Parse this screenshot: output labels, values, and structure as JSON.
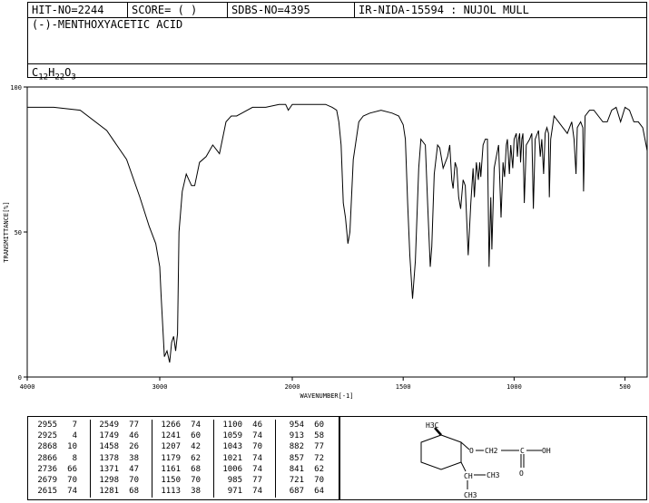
{
  "header": {
    "hit_no": "HIT-NO=2244",
    "score": "SCORE=  (   )",
    "sdbs_no": "SDBS-NO=4395",
    "ir_no": "IR-NIDA-15594 : NUJOL MULL",
    "compound": "(-)-MENTHOXYACETIC ACID",
    "formula": {
      "c": "C",
      "n1": "12",
      "h": "H",
      "n2": "22",
      "o": "O",
      "n3": "3"
    }
  },
  "chart_data": {
    "type": "line",
    "xlabel": "WAVENUMBER[-1]",
    "ylabel": "TRANSMITTANCE[%]",
    "xlim": [
      4000,
      400
    ],
    "ylim": [
      0,
      100
    ],
    "x_ticks": [
      4000,
      3000,
      2000,
      1500,
      1000,
      500
    ],
    "y_ticks": [
      0,
      50,
      100
    ],
    "x": [
      4000,
      3800,
      3600,
      3400,
      3250,
      3150,
      3080,
      3030,
      3000,
      2990,
      2965,
      2945,
      2925,
      2910,
      2895,
      2880,
      2866,
      2855,
      2830,
      2800,
      2760,
      2736,
      2700,
      2650,
      2600,
      2549,
      2500,
      2460,
      2420,
      2380,
      2300,
      2200,
      2100,
      2050,
      2030,
      2000,
      1950,
      1900,
      1850,
      1820,
      1800,
      1790,
      1780,
      1770,
      1760,
      1749,
      1740,
      1725,
      1700,
      1680,
      1650,
      1600,
      1550,
      1520,
      1500,
      1490,
      1480,
      1470,
      1458,
      1445,
      1430,
      1420,
      1400,
      1390,
      1378,
      1371,
      1360,
      1345,
      1335,
      1320,
      1300,
      1290,
      1281,
      1275,
      1266,
      1258,
      1250,
      1241,
      1230,
      1220,
      1207,
      1195,
      1185,
      1179,
      1170,
      1161,
      1155,
      1150,
      1140,
      1130,
      1120,
      1113,
      1105,
      1100,
      1090,
      1080,
      1070,
      1059,
      1050,
      1043,
      1035,
      1030,
      1021,
      1015,
      1006,
      1000,
      990,
      985,
      980,
      975,
      971,
      965,
      960,
      954,
      945,
      930,
      920,
      913,
      905,
      890,
      882,
      875,
      867,
      860,
      852,
      845,
      841,
      835,
      820,
      800,
      780,
      760,
      740,
      730,
      721,
      715,
      700,
      690,
      687,
      680,
      660,
      640,
      620,
      600,
      580,
      560,
      540,
      520,
      500,
      480,
      460,
      440,
      420,
      400
    ],
    "values": [
      93,
      93,
      92,
      85,
      75,
      62,
      52,
      46,
      38,
      28,
      7,
      9,
      5,
      12,
      14,
      9,
      15,
      50,
      64,
      70,
      66,
      66,
      74,
      76,
      80,
      77,
      88,
      90,
      90,
      91,
      93,
      93,
      94,
      94,
      92,
      94,
      94,
      94,
      94,
      93,
      92,
      88,
      80,
      60,
      55,
      46,
      50,
      75,
      88,
      90,
      91,
      92,
      91,
      90,
      87,
      82,
      60,
      42,
      27,
      40,
      72,
      82,
      80,
      60,
      38,
      45,
      70,
      80,
      79,
      72,
      76,
      80,
      68,
      65,
      74,
      72,
      62,
      58,
      68,
      66,
      42,
      60,
      72,
      62,
      74,
      68,
      74,
      69,
      80,
      82,
      82,
      38,
      62,
      44,
      72,
      76,
      80,
      55,
      74,
      69,
      80,
      82,
      70,
      80,
      72,
      82,
      84,
      76,
      82,
      84,
      74,
      82,
      84,
      60,
      80,
      82,
      84,
      58,
      82,
      85,
      76,
      82,
      70,
      84,
      86,
      84,
      62,
      82,
      90,
      88,
      86,
      84,
      88,
      82,
      70,
      86,
      88,
      86,
      64,
      90,
      92,
      92,
      90,
      88,
      88,
      92,
      93,
      88,
      93,
      92,
      88,
      88,
      86,
      78
    ],
    "grid": false
  },
  "peaks": [
    [
      [
        "2955",
        "7"
      ],
      [
        "2925",
        "4"
      ],
      [
        "2868",
        "10"
      ],
      [
        "2866",
        "8"
      ],
      [
        "2736",
        "66"
      ],
      [
        "2679",
        "70"
      ],
      [
        "2615",
        "74"
      ]
    ],
    [
      [
        "2549",
        "77"
      ],
      [
        "1749",
        "46"
      ],
      [
        "1458",
        "26"
      ],
      [
        "1378",
        "38"
      ],
      [
        "1371",
        "47"
      ],
      [
        "1298",
        "70"
      ],
      [
        "1281",
        "68"
      ]
    ],
    [
      [
        "1266",
        "74"
      ],
      [
        "1241",
        "60"
      ],
      [
        "1207",
        "42"
      ],
      [
        "1179",
        "62"
      ],
      [
        "1161",
        "68"
      ],
      [
        "1150",
        "70"
      ],
      [
        "1113",
        "38"
      ]
    ],
    [
      [
        "1100",
        "46"
      ],
      [
        "1059",
        "74"
      ],
      [
        "1043",
        "70"
      ],
      [
        "1021",
        "74"
      ],
      [
        "1006",
        "74"
      ],
      [
        "985",
        "77"
      ],
      [
        "971",
        "74"
      ]
    ],
    [
      [
        "954",
        "60"
      ],
      [
        "913",
        "58"
      ],
      [
        "882",
        "77"
      ],
      [
        "857",
        "72"
      ],
      [
        "841",
        "62"
      ],
      [
        "721",
        "70"
      ],
      [
        "687",
        "64"
      ]
    ]
  ],
  "structure": {
    "methyl_top": "H3C",
    "ether": "O",
    "ch2": "CH2",
    "carbon": "C",
    "oh": "OH",
    "carbonyl_o": "O",
    "ch": "CH",
    "ch3_right": "CH3",
    "ch3_bottom": "CH3"
  }
}
